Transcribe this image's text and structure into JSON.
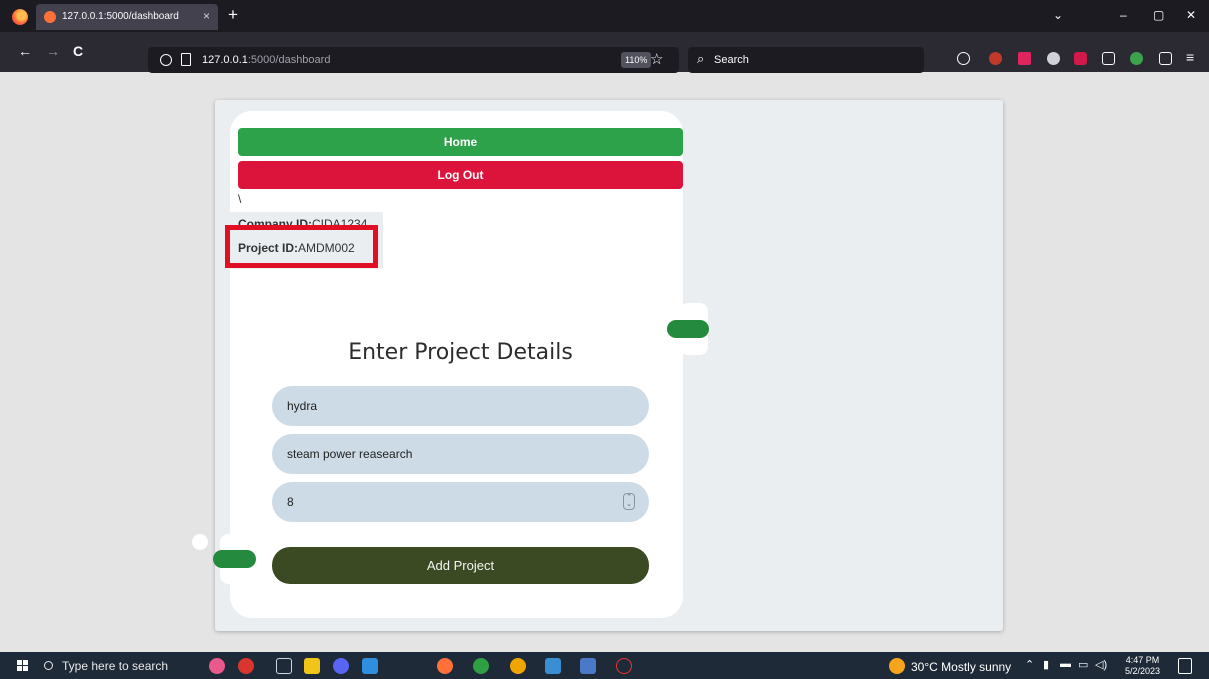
{
  "browser": {
    "tab_title": "127.0.0.1:5000/dashboard",
    "tab_close": "×",
    "new_tab": "+",
    "url_host": "127.0.0.1",
    "url_path": ":5000/dashboard",
    "zoom": "110%",
    "search_placeholder": "Search",
    "nav_back": "←",
    "nav_forward": "→",
    "nav_reload": "C",
    "window_minimize": "–",
    "window_restore": "▢",
    "window_close": "✕",
    "tab_list": "⌄"
  },
  "page": {
    "home_label": "Home",
    "logout_label": "Log Out",
    "stray_text": "\\",
    "company_label": "Company ID:",
    "company_value": "CIDA1234",
    "project_label": "Project ID:",
    "project_value": "AMDM002",
    "form_title": "Enter Project Details",
    "field_name": "hydra",
    "field_description": "steam power reasearch",
    "field_number": "8",
    "add_button": "Add Project",
    "highlight_color": "#e00f24"
  },
  "taskbar": {
    "search_placeholder": "Type here to search",
    "weather": "30°C  Mostly sunny",
    "time": "4:47 PM",
    "date": "5/2/2023"
  }
}
